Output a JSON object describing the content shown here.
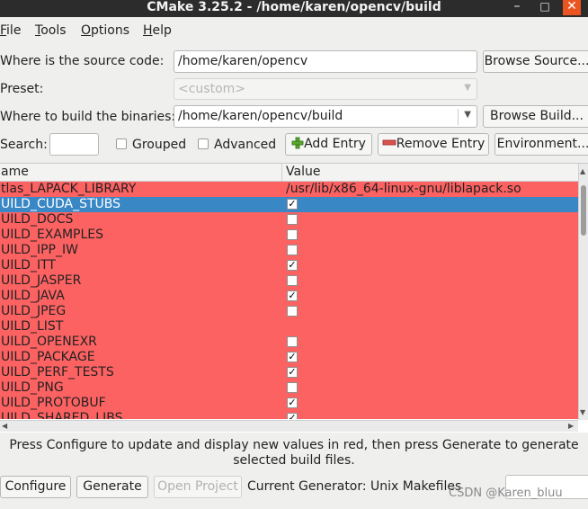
{
  "window": {
    "title": "CMake 3.25.2 - /home/karen/opencv/build",
    "min_glyph": "–",
    "max_glyph": "□",
    "close_glyph": "✕"
  },
  "menu": [
    {
      "label": "File"
    },
    {
      "label": "Tools"
    },
    {
      "label": "Options"
    },
    {
      "label": "Help"
    }
  ],
  "source": {
    "label": "Where is the source code:",
    "value": "/home/karen/opencv",
    "browse_label": "Browse Source..."
  },
  "preset": {
    "label": "Preset:",
    "value": "<custom>"
  },
  "build": {
    "label": "Where to build the binaries:",
    "value": "/home/karen/opencv/build",
    "browse_label": "Browse Build..."
  },
  "toolbar": {
    "search_label": "Search:",
    "search_value": "",
    "grouped_label": "Grouped",
    "grouped_checked": false,
    "advanced_label": "Advanced",
    "advanced_checked": false,
    "add_entry_label": "Add Entry",
    "remove_entry_label": "Remove Entry",
    "environment_label": "Environment..."
  },
  "table": {
    "columns": [
      "ame",
      "Value"
    ],
    "rows": [
      {
        "name": "tlas_LAPACK_LIBRARY",
        "value": "/usr/lib/x86_64-linux-gnu/liblapack.so",
        "type": "text",
        "selected": false
      },
      {
        "name": "UILD_CUDA_STUBS",
        "checked": true,
        "type": "bool",
        "selected": true
      },
      {
        "name": "UILD_DOCS",
        "checked": false,
        "type": "bool",
        "selected": false
      },
      {
        "name": "UILD_EXAMPLES",
        "checked": false,
        "type": "bool",
        "selected": false
      },
      {
        "name": "UILD_IPP_IW",
        "checked": false,
        "type": "bool",
        "selected": false
      },
      {
        "name": "UILD_ITT",
        "checked": true,
        "type": "bool",
        "selected": false
      },
      {
        "name": "UILD_JASPER",
        "checked": false,
        "type": "bool",
        "selected": false
      },
      {
        "name": "UILD_JAVA",
        "checked": true,
        "type": "bool",
        "selected": false
      },
      {
        "name": "UILD_JPEG",
        "checked": false,
        "type": "bool",
        "selected": false
      },
      {
        "name": "UILD_LIST",
        "value": "",
        "type": "text",
        "selected": false
      },
      {
        "name": "UILD_OPENEXR",
        "checked": false,
        "type": "bool",
        "selected": false
      },
      {
        "name": "UILD_PACKAGE",
        "checked": true,
        "type": "bool",
        "selected": false
      },
      {
        "name": "UILD_PERF_TESTS",
        "checked": true,
        "type": "bool",
        "selected": false
      },
      {
        "name": "UILD_PNG",
        "checked": false,
        "type": "bool",
        "selected": false
      },
      {
        "name": "UILD_PROTOBUF",
        "checked": true,
        "type": "bool",
        "selected": false
      },
      {
        "name": "UILD_SHARED_LIBS",
        "checked": true,
        "type": "bool",
        "selected": false
      }
    ],
    "check_glyph": "✓"
  },
  "info_text": "Press Configure to update and display new values in red, then press Generate to generate selected build files.",
  "bottom": {
    "configure_label": "Configure",
    "generate_label": "Generate",
    "open_project_label": "Open Project",
    "generator_text": "Current Generator: Unix Makefiles"
  },
  "watermark": "CSDN @Karen_bluu",
  "colors": {
    "changed_row": "#fd6262",
    "selected_row": "#3a87c6",
    "title_bar": "#2c2c2c",
    "close_button": "#e95420"
  }
}
